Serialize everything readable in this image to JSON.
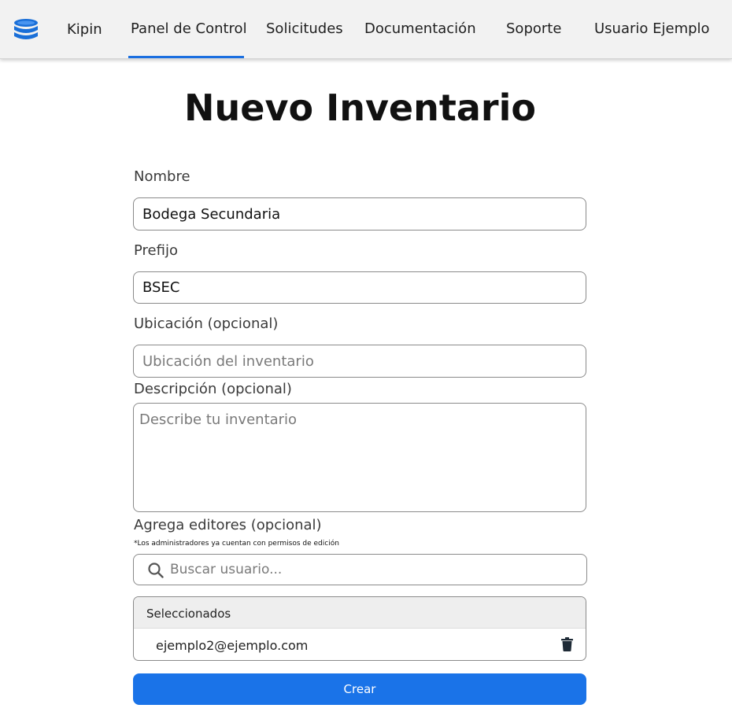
{
  "navbar": {
    "logo_icon": "database-stack-icon",
    "brand": "Kipin",
    "items": [
      "Panel de Control",
      "Solicitudes",
      "Documentación",
      "Soporte",
      "Usuario Ejemplo"
    ],
    "active_item": "Panel de Control",
    "accent_color": "#1b6fe0"
  },
  "page": {
    "title": "Nuevo Inventario"
  },
  "form": {
    "name": {
      "label": "Nombre",
      "value": "Bodega Secundaria"
    },
    "prefix": {
      "label": "Prefijo",
      "value": "BSEC"
    },
    "location": {
      "label": "Ubicación (opcional)",
      "value": "",
      "placeholder": "Ubicación del inventario"
    },
    "description": {
      "label": "Descripción (opcional)",
      "value": "",
      "placeholder": "Describe tu inventario"
    },
    "editors": {
      "label": "Agrega editores (opcional)",
      "hint": "*Los administradores ya cuentan con permisos de edición",
      "search_placeholder": "Buscar usuario...",
      "search_icon": "search-icon",
      "selected_title": "Seleccionados",
      "selected": [
        {
          "email": "ejemplo2@ejemplo.com",
          "remove_icon": "trash-icon"
        }
      ]
    },
    "submit_label": "Crear",
    "submit_color": "#1a73e8"
  }
}
